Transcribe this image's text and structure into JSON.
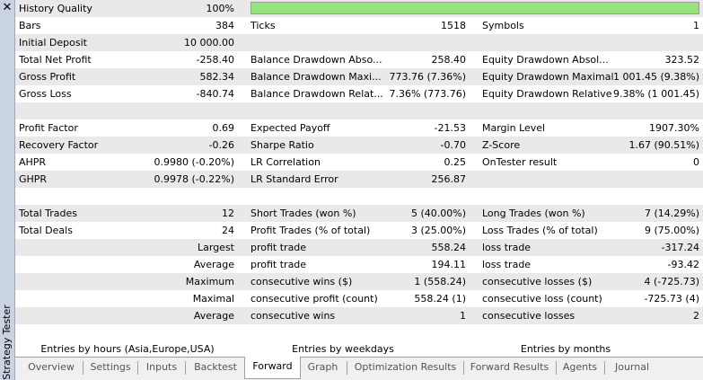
{
  "sidebar": {
    "close_glyph": "✕",
    "title": "Strategy Tester"
  },
  "history_quality": {
    "label": "History Quality",
    "value": "100%",
    "fill_fraction": 1.0,
    "bar_color": "#94e37b"
  },
  "rows": [
    [
      "Bars",
      "384",
      "Ticks",
      "1518",
      "Symbols",
      "1"
    ],
    [
      "Initial Deposit",
      "10 000.00",
      "",
      "",
      "",
      ""
    ],
    [
      "Total Net Profit",
      "-258.40",
      "Balance Drawdown Abso...",
      "258.40",
      "Equity Drawdown Absol...",
      "323.52"
    ],
    [
      "Gross Profit",
      "582.34",
      "Balance Drawdown Maxi...",
      "773.76 (7.36%)",
      "Equity Drawdown Maximal",
      "1 001.45 (9.38%)"
    ],
    [
      "Gross Loss",
      "-840.74",
      "Balance Drawdown Relat...",
      "7.36% (773.76)",
      "Equity Drawdown Relative",
      "9.38% (1 001.45)"
    ],
    [
      "",
      "",
      "",
      "",
      "",
      ""
    ],
    [
      "Profit Factor",
      "0.69",
      "Expected Payoff",
      "-21.53",
      "Margin Level",
      "1907.30%"
    ],
    [
      "Recovery Factor",
      "-0.26",
      "Sharpe Ratio",
      "-0.70",
      "Z-Score",
      "1.67 (90.51%)"
    ],
    [
      "AHPR",
      "0.9980 (-0.20%)",
      "LR Correlation",
      "0.25",
      "OnTester result",
      "0"
    ],
    [
      "GHPR",
      "0.9978 (-0.22%)",
      "LR Standard Error",
      "256.87",
      "",
      ""
    ],
    [
      "",
      "",
      "",
      "",
      "",
      ""
    ],
    [
      "Total Trades",
      "12",
      "Short Trades (won %)",
      "5 (40.00%)",
      "Long Trades (won %)",
      "7 (14.29%)"
    ],
    [
      "Total Deals",
      "24",
      "Profit Trades (% of total)",
      "3 (25.00%)",
      "Loss Trades (% of total)",
      "9 (75.00%)"
    ],
    [
      "",
      "Largest",
      "profit trade",
      "558.24",
      "loss trade",
      "-317.24"
    ],
    [
      "",
      "Average",
      "profit trade",
      "194.11",
      "loss trade",
      "-93.42"
    ],
    [
      "",
      "Maximum",
      "consecutive wins ($)",
      "1 (558.24)",
      "consecutive losses ($)",
      "4 (-725.73)"
    ],
    [
      "",
      "Maximal",
      "consecutive profit (count)",
      "558.24 (1)",
      "consecutive loss (count)",
      "-725.73 (4)"
    ],
    [
      "",
      "Average",
      "consecutive wins",
      "1",
      "consecutive losses",
      "2"
    ]
  ],
  "entries": [
    "Entries by hours (Asia,Europe,USA)",
    "Entries by weekdays",
    "Entries by months"
  ],
  "tabs": [
    "Overview",
    "Settings",
    "Inputs",
    "Backtest",
    "Forward",
    "Graph",
    "Optimization Results",
    "Forward Results",
    "Agents",
    "Journal"
  ],
  "active_tab": "Forward"
}
